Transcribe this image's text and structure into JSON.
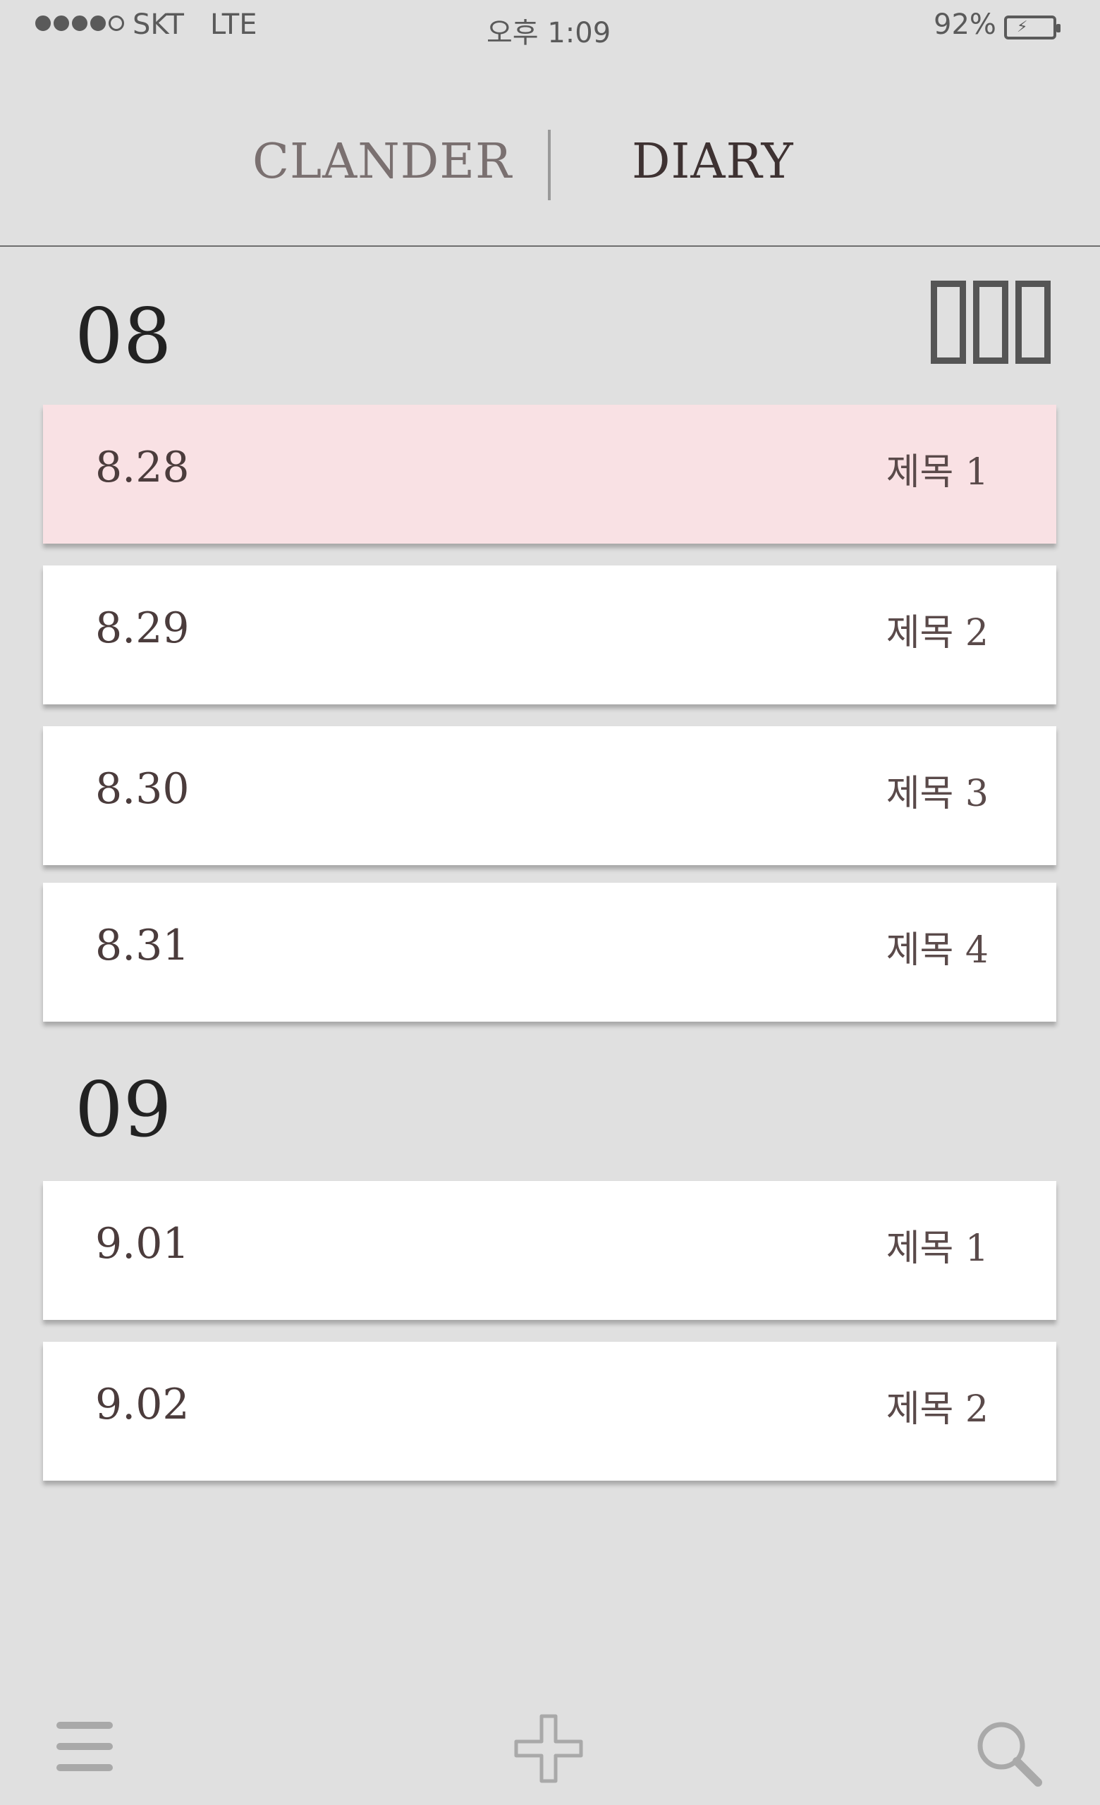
{
  "status": {
    "carrier": "SKT",
    "network": "LTE",
    "time": "오후 1:09",
    "battery": "92%"
  },
  "tabs": {
    "calendar": "CLANDER",
    "diary": "DIARY"
  },
  "sections": [
    {
      "month": "08",
      "entries": [
        {
          "date": "8.28",
          "title": "제목 1"
        },
        {
          "date": "8.29",
          "title": "제목 2"
        },
        {
          "date": "8.30",
          "title": "제목 3"
        },
        {
          "date": "8.31",
          "title": "제목 4"
        }
      ]
    },
    {
      "month": "09",
      "entries": [
        {
          "date": "9.01",
          "title": "제목 1"
        },
        {
          "date": "9.02",
          "title": "제목 2"
        }
      ]
    }
  ],
  "colors": {
    "background": "#e0e0e0",
    "selected_row": "#f9e1e4",
    "row": "#ffffff",
    "text": "#4b3c3c"
  },
  "icons": {
    "view_toggle": "grid-view-icon",
    "menu": "hamburger-menu-icon",
    "add": "plus-icon",
    "search": "search-icon"
  }
}
